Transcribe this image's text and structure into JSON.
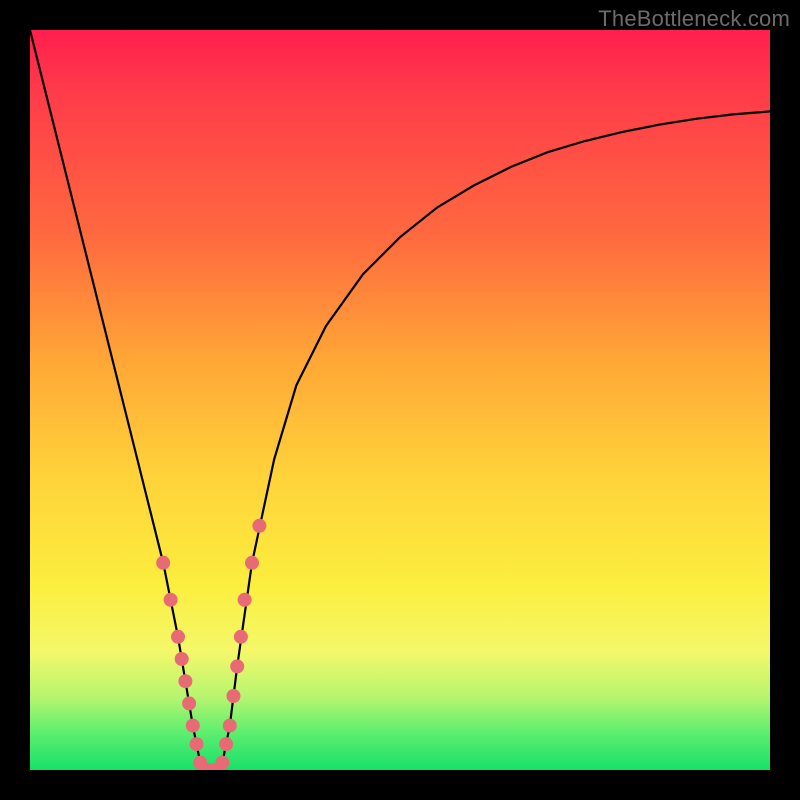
{
  "watermark": "TheBottleneck.com",
  "colors": {
    "frame": "#000000",
    "gradient_top": "#ff1f4e",
    "gradient_bottom": "#17e06a",
    "curve": "#000000",
    "marker": "#e86a75"
  },
  "chart_data": {
    "type": "line",
    "title": "",
    "xlabel": "",
    "ylabel": "",
    "xlim": [
      0,
      100
    ],
    "ylim": [
      0,
      100
    ],
    "series": [
      {
        "name": "bottleneck-curve",
        "x": [
          0,
          2,
          4,
          6,
          8,
          10,
          12,
          14,
          16,
          18,
          20,
          21,
          22,
          23,
          24,
          25,
          26,
          27,
          28,
          30,
          33,
          36,
          40,
          45,
          50,
          55,
          60,
          65,
          70,
          75,
          80,
          85,
          90,
          95,
          100
        ],
        "y": [
          100,
          92,
          84,
          76,
          68,
          60,
          52,
          44,
          36,
          28,
          18,
          12,
          6,
          1,
          0,
          0,
          1,
          6,
          14,
          28,
          42,
          52,
          60,
          67,
          72,
          76,
          79,
          81.5,
          83.5,
          85,
          86.2,
          87.2,
          88,
          88.6,
          89
        ]
      }
    ],
    "markers": {
      "name": "highlighted-points",
      "x": [
        18,
        19,
        20,
        20.5,
        21,
        21.5,
        22,
        22.5,
        23,
        24,
        25,
        26,
        26.5,
        27,
        27.5,
        28,
        28.5,
        29,
        30,
        31
      ],
      "y": [
        28,
        23,
        18,
        15,
        12,
        9,
        6,
        3.5,
        1,
        0,
        0,
        1,
        3.5,
        6,
        10,
        14,
        18,
        23,
        28,
        33
      ]
    }
  }
}
